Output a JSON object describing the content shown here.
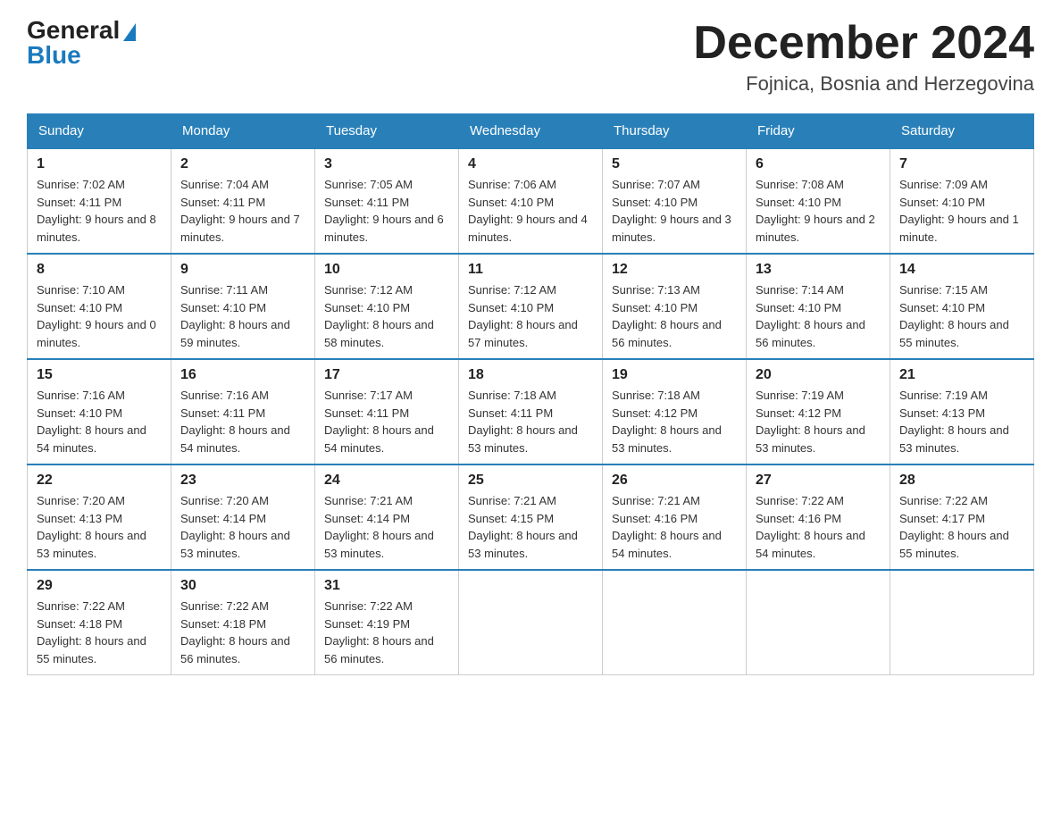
{
  "header": {
    "logo_general": "General",
    "logo_blue": "Blue",
    "month_title": "December 2024",
    "location": "Fojnica, Bosnia and Herzegovina"
  },
  "days_of_week": [
    "Sunday",
    "Monday",
    "Tuesday",
    "Wednesday",
    "Thursday",
    "Friday",
    "Saturday"
  ],
  "weeks": [
    [
      {
        "day": "1",
        "sunrise": "7:02 AM",
        "sunset": "4:11 PM",
        "daylight": "9 hours and 8 minutes."
      },
      {
        "day": "2",
        "sunrise": "7:04 AM",
        "sunset": "4:11 PM",
        "daylight": "9 hours and 7 minutes."
      },
      {
        "day": "3",
        "sunrise": "7:05 AM",
        "sunset": "4:11 PM",
        "daylight": "9 hours and 6 minutes."
      },
      {
        "day": "4",
        "sunrise": "7:06 AM",
        "sunset": "4:10 PM",
        "daylight": "9 hours and 4 minutes."
      },
      {
        "day": "5",
        "sunrise": "7:07 AM",
        "sunset": "4:10 PM",
        "daylight": "9 hours and 3 minutes."
      },
      {
        "day": "6",
        "sunrise": "7:08 AM",
        "sunset": "4:10 PM",
        "daylight": "9 hours and 2 minutes."
      },
      {
        "day": "7",
        "sunrise": "7:09 AM",
        "sunset": "4:10 PM",
        "daylight": "9 hours and 1 minute."
      }
    ],
    [
      {
        "day": "8",
        "sunrise": "7:10 AM",
        "sunset": "4:10 PM",
        "daylight": "9 hours and 0 minutes."
      },
      {
        "day": "9",
        "sunrise": "7:11 AM",
        "sunset": "4:10 PM",
        "daylight": "8 hours and 59 minutes."
      },
      {
        "day": "10",
        "sunrise": "7:12 AM",
        "sunset": "4:10 PM",
        "daylight": "8 hours and 58 minutes."
      },
      {
        "day": "11",
        "sunrise": "7:12 AM",
        "sunset": "4:10 PM",
        "daylight": "8 hours and 57 minutes."
      },
      {
        "day": "12",
        "sunrise": "7:13 AM",
        "sunset": "4:10 PM",
        "daylight": "8 hours and 56 minutes."
      },
      {
        "day": "13",
        "sunrise": "7:14 AM",
        "sunset": "4:10 PM",
        "daylight": "8 hours and 56 minutes."
      },
      {
        "day": "14",
        "sunrise": "7:15 AM",
        "sunset": "4:10 PM",
        "daylight": "8 hours and 55 minutes."
      }
    ],
    [
      {
        "day": "15",
        "sunrise": "7:16 AM",
        "sunset": "4:10 PM",
        "daylight": "8 hours and 54 minutes."
      },
      {
        "day": "16",
        "sunrise": "7:16 AM",
        "sunset": "4:11 PM",
        "daylight": "8 hours and 54 minutes."
      },
      {
        "day": "17",
        "sunrise": "7:17 AM",
        "sunset": "4:11 PM",
        "daylight": "8 hours and 54 minutes."
      },
      {
        "day": "18",
        "sunrise": "7:18 AM",
        "sunset": "4:11 PM",
        "daylight": "8 hours and 53 minutes."
      },
      {
        "day": "19",
        "sunrise": "7:18 AM",
        "sunset": "4:12 PM",
        "daylight": "8 hours and 53 minutes."
      },
      {
        "day": "20",
        "sunrise": "7:19 AM",
        "sunset": "4:12 PM",
        "daylight": "8 hours and 53 minutes."
      },
      {
        "day": "21",
        "sunrise": "7:19 AM",
        "sunset": "4:13 PM",
        "daylight": "8 hours and 53 minutes."
      }
    ],
    [
      {
        "day": "22",
        "sunrise": "7:20 AM",
        "sunset": "4:13 PM",
        "daylight": "8 hours and 53 minutes."
      },
      {
        "day": "23",
        "sunrise": "7:20 AM",
        "sunset": "4:14 PM",
        "daylight": "8 hours and 53 minutes."
      },
      {
        "day": "24",
        "sunrise": "7:21 AM",
        "sunset": "4:14 PM",
        "daylight": "8 hours and 53 minutes."
      },
      {
        "day": "25",
        "sunrise": "7:21 AM",
        "sunset": "4:15 PM",
        "daylight": "8 hours and 53 minutes."
      },
      {
        "day": "26",
        "sunrise": "7:21 AM",
        "sunset": "4:16 PM",
        "daylight": "8 hours and 54 minutes."
      },
      {
        "day": "27",
        "sunrise": "7:22 AM",
        "sunset": "4:16 PM",
        "daylight": "8 hours and 54 minutes."
      },
      {
        "day": "28",
        "sunrise": "7:22 AM",
        "sunset": "4:17 PM",
        "daylight": "8 hours and 55 minutes."
      }
    ],
    [
      {
        "day": "29",
        "sunrise": "7:22 AM",
        "sunset": "4:18 PM",
        "daylight": "8 hours and 55 minutes."
      },
      {
        "day": "30",
        "sunrise": "7:22 AM",
        "sunset": "4:18 PM",
        "daylight": "8 hours and 56 minutes."
      },
      {
        "day": "31",
        "sunrise": "7:22 AM",
        "sunset": "4:19 PM",
        "daylight": "8 hours and 56 minutes."
      },
      null,
      null,
      null,
      null
    ]
  ],
  "labels": {
    "sunrise_prefix": "Sunrise: ",
    "sunset_prefix": "Sunset: ",
    "daylight_prefix": "Daylight: "
  }
}
